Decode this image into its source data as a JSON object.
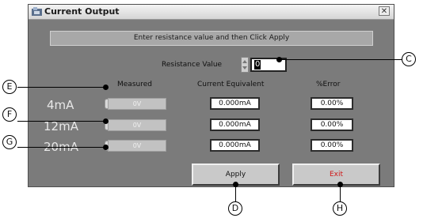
{
  "window": {
    "title": "Current Output",
    "close_symbol": "✕"
  },
  "instruction": "Enter resistance value and then Click Apply",
  "resistance": {
    "label": "Resistance Value",
    "value": "0"
  },
  "columns": {
    "measured": "Measured",
    "current_equivalent": "Current Equivalent",
    "error": "%Error"
  },
  "rows": [
    {
      "label": "4mA",
      "measured": "0V",
      "current": "0.000mA",
      "error": "0.00%"
    },
    {
      "label": "12mA",
      "measured": "0V",
      "current": "0.000mA",
      "error": "0.00%"
    },
    {
      "label": "20mA",
      "measured": "0V",
      "current": "0.000mA",
      "error": "0.00%"
    }
  ],
  "buttons": {
    "apply": "Apply",
    "exit": "Exit"
  },
  "callouts": {
    "c": "C",
    "d": "D",
    "e": "E",
    "f": "F",
    "g": "G",
    "h": "H"
  },
  "colors": {
    "exit_text": "#d01818",
    "window_bg": "#7b7b7b"
  }
}
